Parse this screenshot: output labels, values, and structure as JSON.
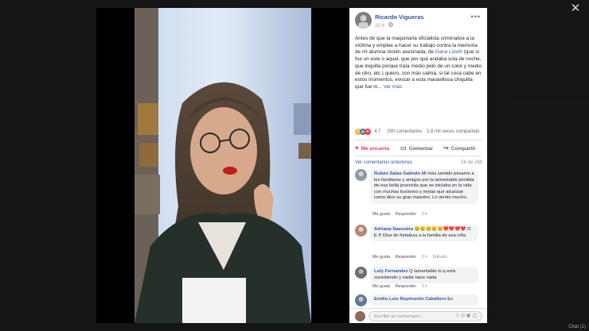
{
  "viewer": {
    "close_label": "✕"
  },
  "post": {
    "author": "Ricardo Vigueras",
    "time": "22 h",
    "privacy_icon": "globe-icon",
    "more": "•••",
    "text_before_link": "Antes de que la maquinaria oficialista criminalice a la víctima y emplee a hacer su trabajo contra la memoria de mi alumna recién asesinada, de ",
    "link_name": "Dana Lizeth",
    "text_after_link": " (que si fue un este o aquel, que por qué andaba sola de noche, que loquilla porque traía medio pelo de un color y medio de otro, etc.) quiero, con más calma, si tal cosa cabe en estos momentos, evocar a esta maravillosa chiquilla que fue m...",
    "see_more": " Ver más",
    "reaction_count": "4.7",
    "comments_count": "290 comentarios",
    "shares_count": "1.8 mil veces compartido",
    "like_label": "Me encanta",
    "comment_label": "Comentar",
    "share_label": "Compartir"
  },
  "comments_section": {
    "previous_label": "Ver comentarios anteriores",
    "count_label": "56 de 268",
    "items": [
      {
        "name": "Rubén Salas Galindo",
        "text": " Mi más sentido pésame a los familiares y amigos por la lamentable perdida de esa bella jovencita que se iniciaba en la vida con muchas ilusiones y metas que alcanzar como dice su gran maestro. Lo siento mucho.",
        "like": "Me gusta",
        "reply": "Responder",
        "time": "3 h",
        "edited": ""
      },
      {
        "name": "Adriana Saavedra",
        "text": " 😢😢😢😢😢❤️❤️❤️❤️ D E P Dios de fortaleza a la familia de esa niña",
        "like": "Me gusta",
        "reply": "Responder",
        "time": "3 h",
        "edited": "Editado"
      },
      {
        "name": "Luly Fernandez",
        "text": " Q lamentable lo q está sucediendo y nadie hace nada",
        "like": "Me gusta",
        "reply": "Responder",
        "time": "3 h",
        "edited": ""
      },
      {
        "name": "Emilio Luis Raymundo Caballero",
        "text": " Es",
        "like": "",
        "reply": "",
        "time": "",
        "edited": ""
      }
    ]
  },
  "composer": {
    "placeholder": "Escribe un comentario..."
  },
  "footer": {
    "corner_text": "Chat (1)"
  },
  "colors": {
    "accent": "#365899",
    "love": "#f33e58",
    "overlay": "#141414"
  }
}
